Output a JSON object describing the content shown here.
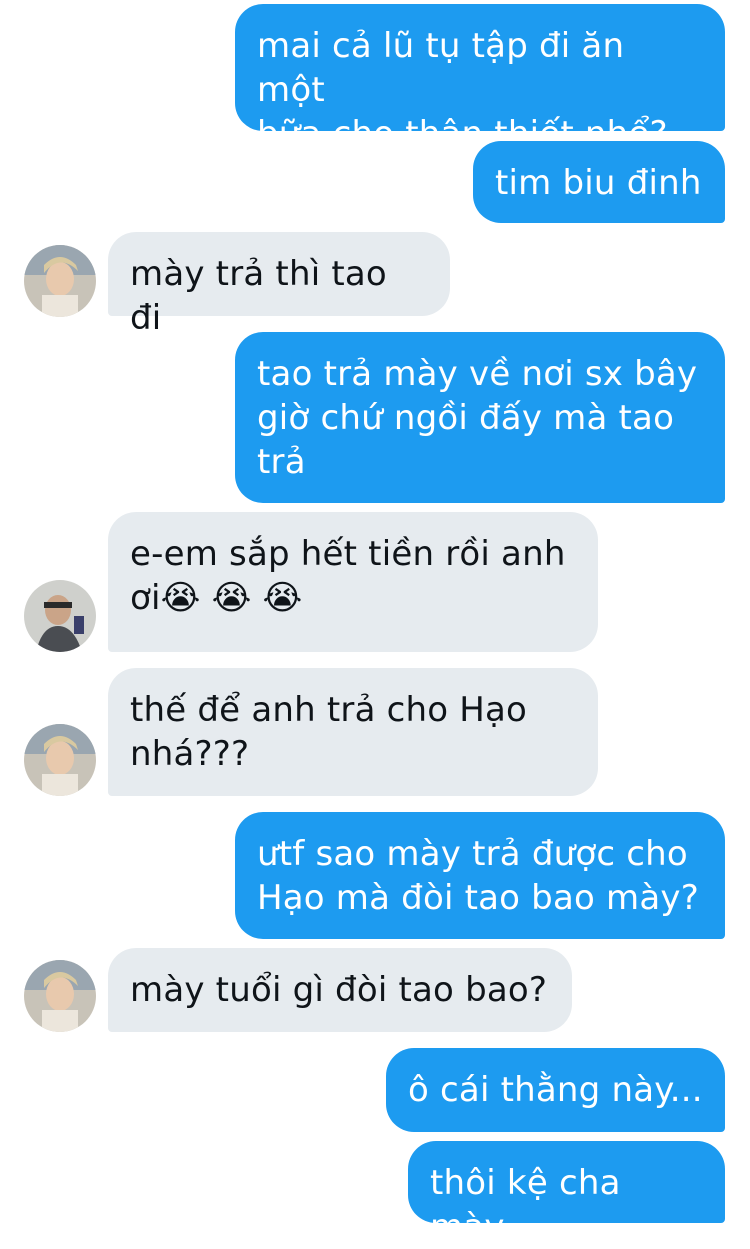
{
  "conversation": {
    "messages": [
      {
        "text": "mai cả lũ tụ tập đi ăn một\nbữa cho thân thiết nhể?"
      },
      {
        "text": "tim biu đinh"
      },
      {
        "text": "mày trả thì tao đi"
      },
      {
        "text": "tao trả mày về nơi sx bây\ngiờ chứ ngồi đấy mà tao\ntrả"
      },
      {
        "text": "e-em sắp hết tiền rồi anh\nơi😭 😭 😭"
      },
      {
        "text": "thế để anh trả cho Hạo\nnhá???"
      },
      {
        "text": "ưtf sao mày trả được cho\nHạo mà đòi tao bao mày?"
      },
      {
        "text": "mày tuổi gì đòi tao bao?"
      },
      {
        "text": "ô cái thằng này..."
      },
      {
        "text": "thôi kệ cha mày"
      }
    ]
  },
  "colors": {
    "outgoing_bubble": "#1d9bf0",
    "incoming_bubble": "#e6ebef",
    "outgoing_text": "#ffffff",
    "incoming_text": "#0f1419"
  }
}
